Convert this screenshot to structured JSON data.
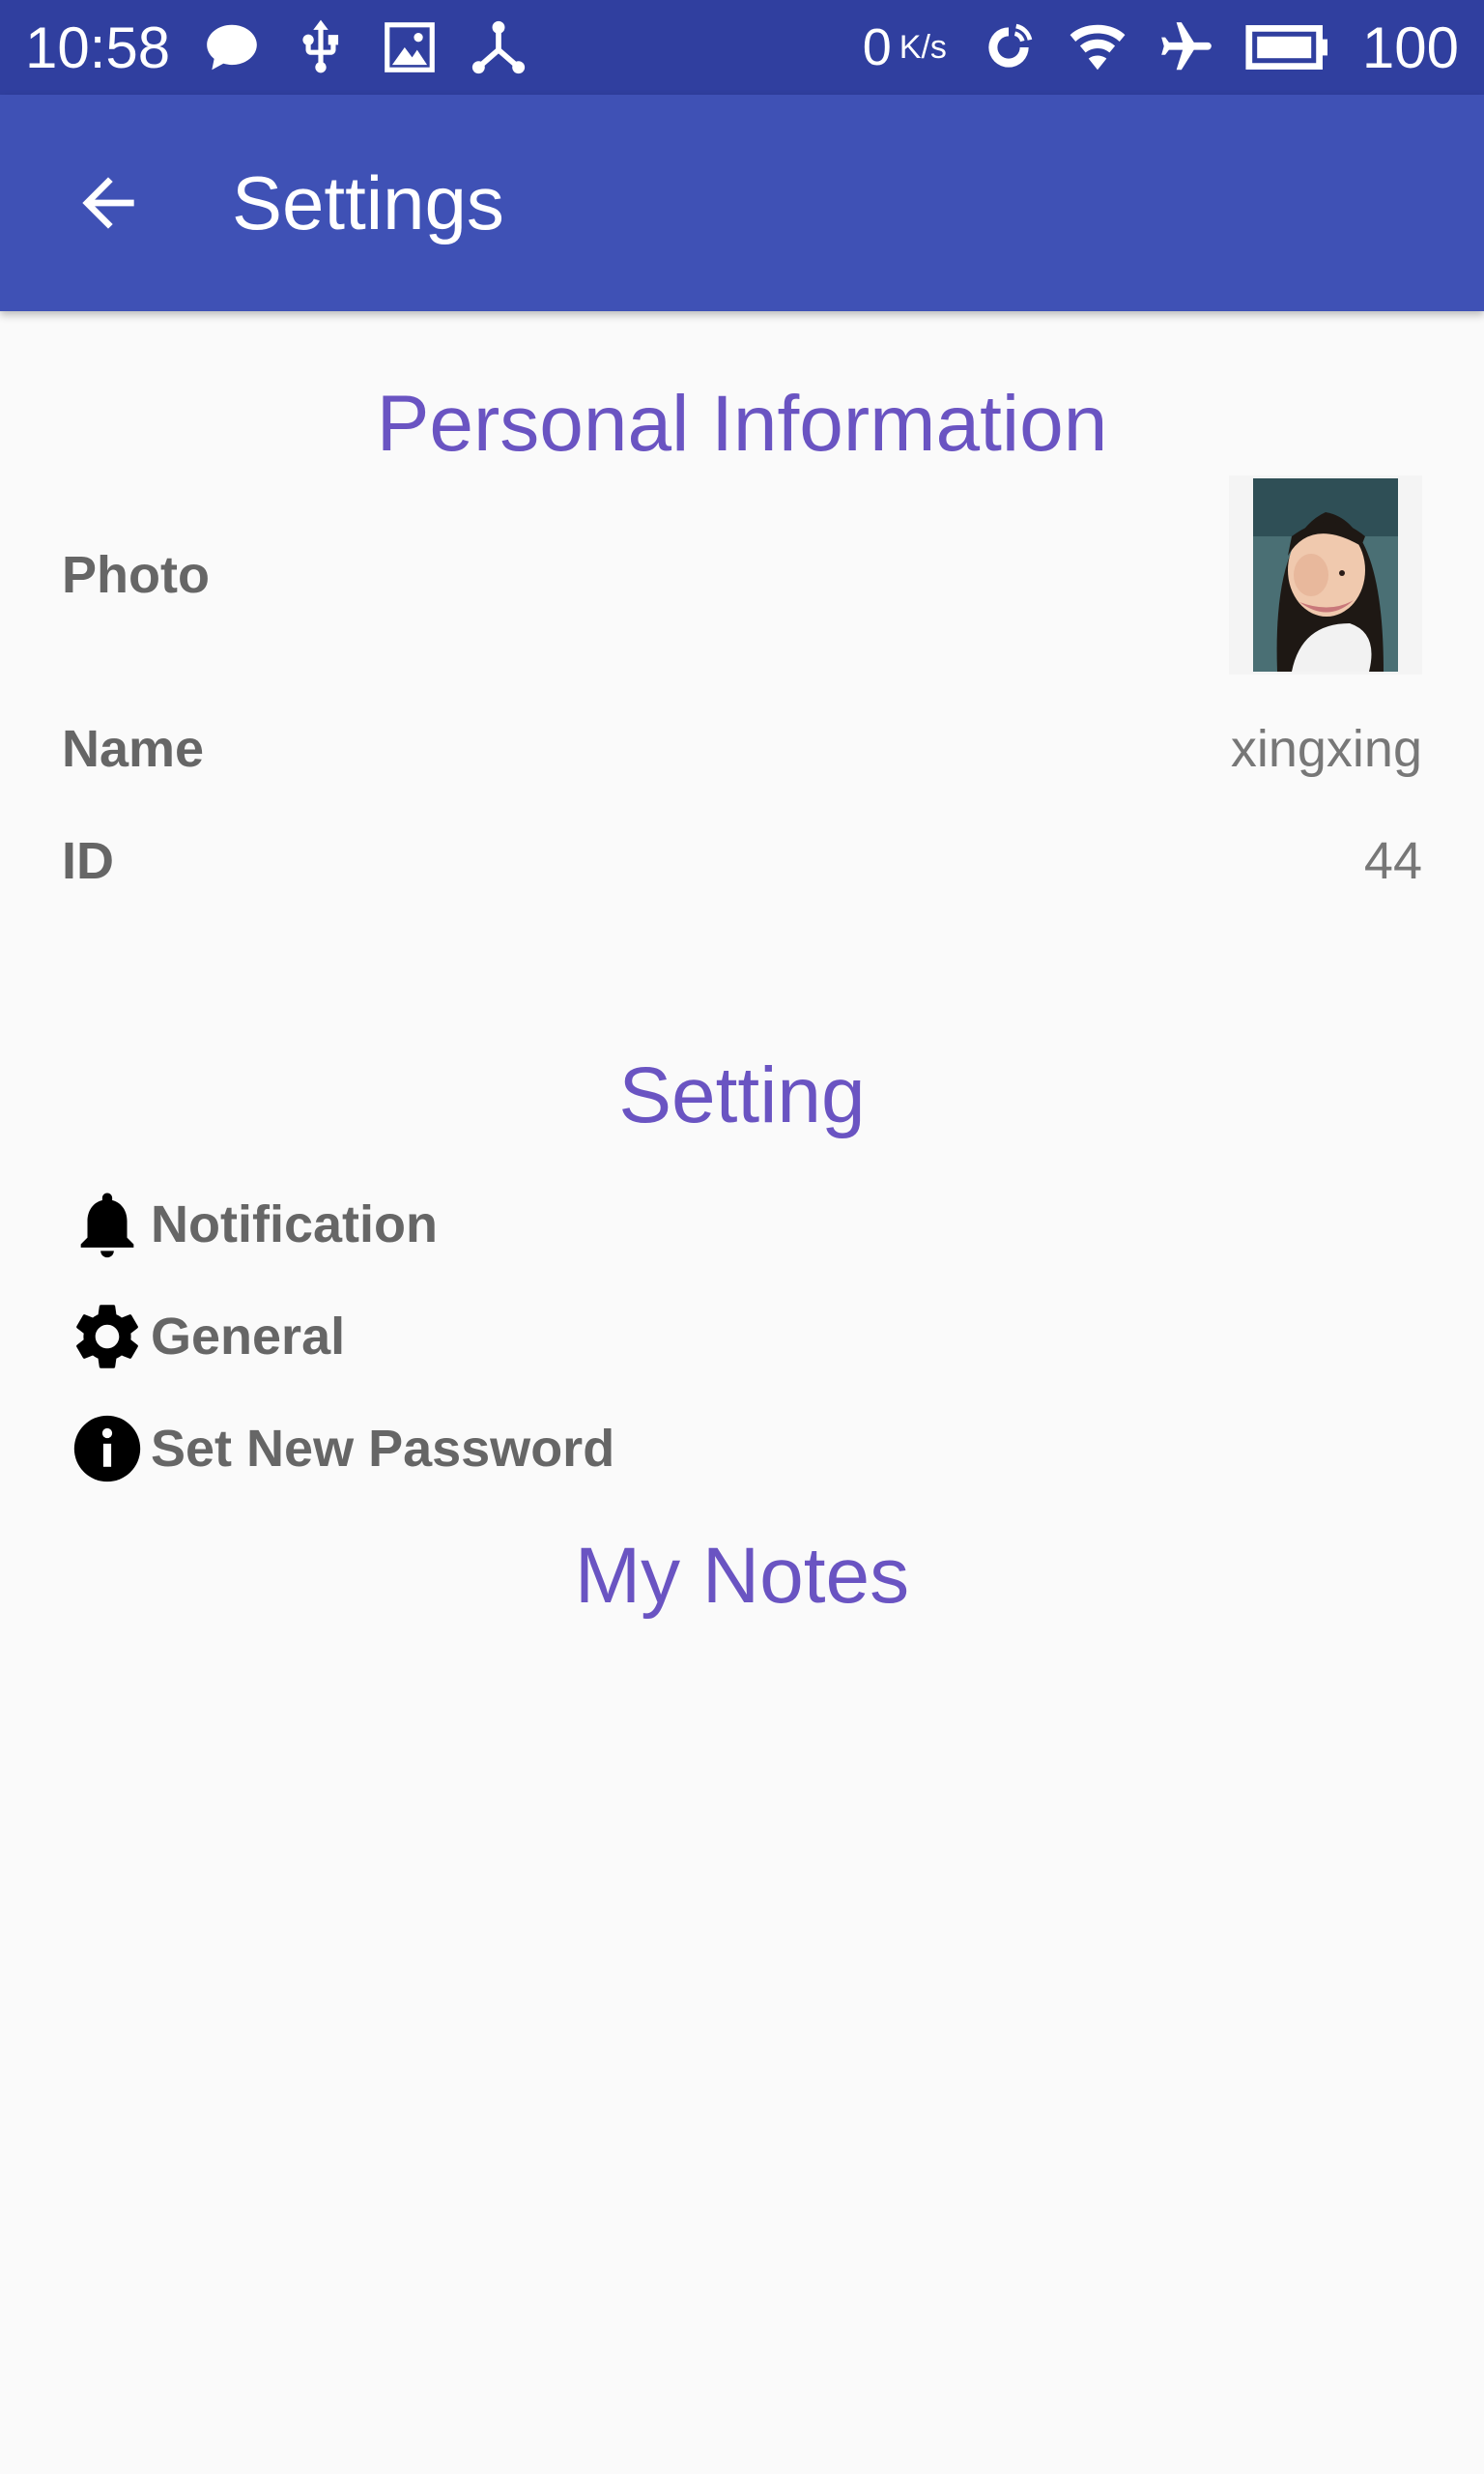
{
  "status_bar": {
    "time": "10:58",
    "speed_value": "0",
    "speed_unit": "K/s",
    "battery": "100",
    "left_icons": [
      "chat-bubble-icon",
      "usb-icon",
      "image-icon",
      "share-nodes-icon"
    ],
    "right_icons": [
      "data-saver-icon",
      "wifi-icon",
      "airplane-mode-icon",
      "battery-icon"
    ]
  },
  "app_bar": {
    "title": "Settings",
    "back_icon": "arrow-back-icon",
    "background": "#3f51b5",
    "status_background": "#303f9f"
  },
  "personal_info": {
    "heading": "Personal Information",
    "photo_label": "Photo",
    "name_label": "Name",
    "name_value": "xingxing",
    "id_label": "ID",
    "id_value": "44"
  },
  "settings": {
    "heading": "Setting",
    "items": [
      {
        "label": "Notification",
        "icon": "bell-icon"
      },
      {
        "label": "General",
        "icon": "gear-icon"
      },
      {
        "label": "Set New Password",
        "icon": "info-icon"
      }
    ]
  },
  "notes": {
    "heading": "My Notes"
  },
  "colors": {
    "accent_heading": "#6a54c2",
    "label_text": "#666666"
  }
}
